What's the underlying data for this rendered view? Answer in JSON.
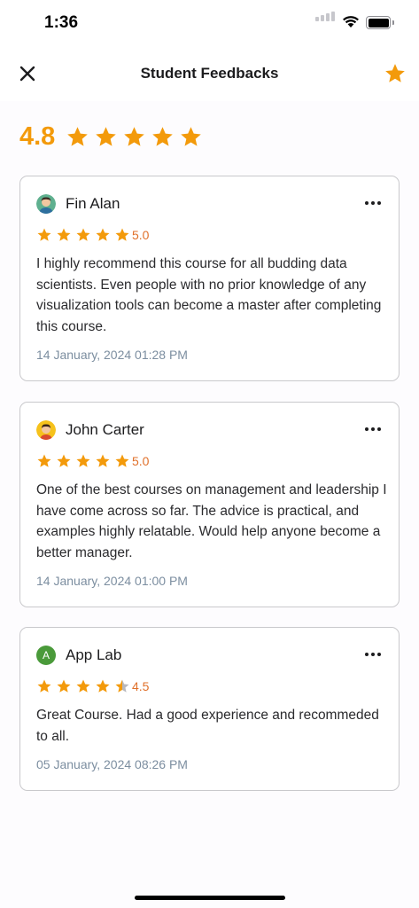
{
  "status_bar": {
    "time": "1:36"
  },
  "nav": {
    "title": "Student Feedbacks",
    "close_icon": "close-icon",
    "favorite_icon": "star-icon"
  },
  "overall": {
    "rating": "4.8",
    "stars": 5
  },
  "colors": {
    "accent": "#f39a0b",
    "score": "#e0702a",
    "date": "#7c8ea0",
    "border": "#c9c9cc"
  },
  "reviews": [
    {
      "name": "Fin Alan",
      "avatar": "avatar-photo",
      "stars": 5,
      "score": "5.0",
      "text": "I highly recommend this course for all budding data scientists. Even people with no prior knowledge of any visualization tools can become a master after completing this course.",
      "date": "14 January, 2024 01:28 PM"
    },
    {
      "name": "John Carter",
      "avatar": "avatar-photo",
      "stars": 5,
      "score": "5.0",
      "text": "One of the best courses on management and leadership I have come across so far. The advice is practical, and examples highly relatable. Would help anyone become a better manager.",
      "date": "14 January, 2024 01:00 PM"
    },
    {
      "name": "App Lab",
      "avatar_letter": "A",
      "stars": 4.5,
      "score": "4.5",
      "text": "Great Course. Had a good experience and recommeded to all.",
      "date": "05 January, 2024 08:26 PM"
    }
  ]
}
